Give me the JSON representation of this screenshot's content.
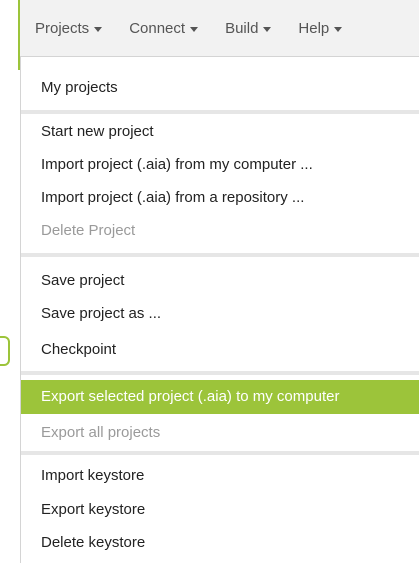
{
  "accent_color": "#9cc43a",
  "menubar": {
    "items": [
      {
        "label": "Projects"
      },
      {
        "label": "Connect"
      },
      {
        "label": "Build"
      },
      {
        "label": "Help"
      }
    ]
  },
  "dropdown": {
    "groups": [
      {
        "items": [
          {
            "label": "My projects",
            "enabled": true
          }
        ]
      },
      {
        "items": [
          {
            "label": "Start new project",
            "enabled": true
          },
          {
            "label": "Import project (.aia) from my computer ...",
            "enabled": true
          },
          {
            "label": "Import project (.aia) from a repository ...",
            "enabled": true
          },
          {
            "label": "Delete Project",
            "enabled": false
          }
        ]
      },
      {
        "items": [
          {
            "label": "Save project",
            "enabled": true
          },
          {
            "label": "Save project as ...",
            "enabled": true
          },
          {
            "label": "Checkpoint",
            "enabled": true
          }
        ]
      },
      {
        "items": [
          {
            "label": "Export selected project (.aia) to my computer",
            "enabled": true,
            "highlighted": true
          },
          {
            "label": "Export all projects",
            "enabled": false
          }
        ]
      },
      {
        "items": [
          {
            "label": "Import keystore",
            "enabled": true
          },
          {
            "label": "Export keystore",
            "enabled": true
          },
          {
            "label": "Delete keystore",
            "enabled": true
          }
        ]
      }
    ]
  }
}
